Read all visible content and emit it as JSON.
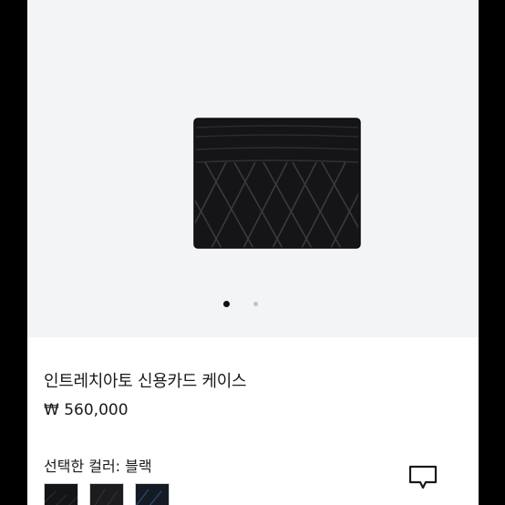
{
  "product": {
    "name": "인트레치아토 신용카드 케이스",
    "price": "₩ 560,000",
    "color_label": "선택한 컬러:",
    "color_value": "블랙"
  },
  "gallery": {
    "image_count": 2,
    "current_image": 1
  },
  "swatches": [
    {
      "name": "black",
      "color": "#141517"
    },
    {
      "name": "black-2",
      "color": "#1c1c1e"
    },
    {
      "name": "navy",
      "color": "#151b24"
    }
  ],
  "icons": {
    "chat": "chat-bubble-icon"
  },
  "colors": {
    "gallery_background": "#f2f4f6",
    "text": "#1a1a1a"
  }
}
